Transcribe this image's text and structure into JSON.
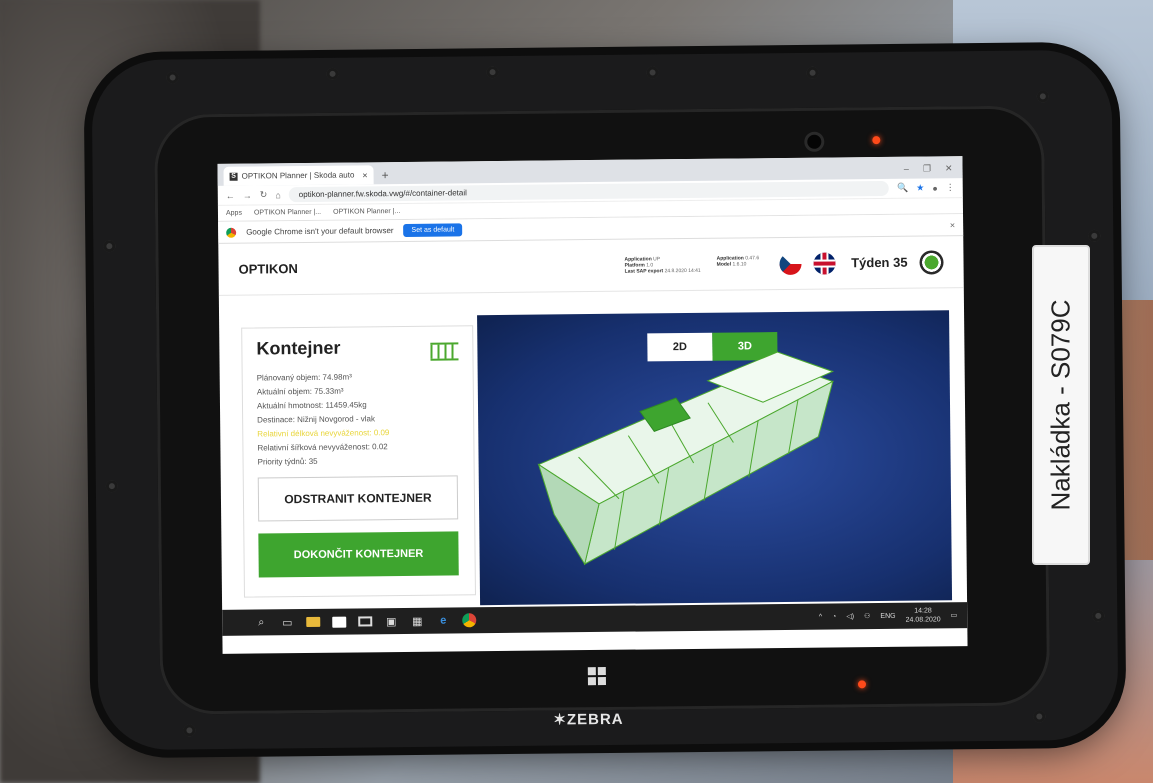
{
  "device": {
    "brand": "ZEBRA",
    "sticker_label": "Nakládka - S079C"
  },
  "browser": {
    "tab_title": "OPTIKON Planner | Skoda auto",
    "url": "optikon-planner.fw.skoda.vwg/#/container-detail",
    "bookmarks": [
      "Apps",
      "OPTIKON Planner |...",
      "OPTIKON Planner |..."
    ],
    "infobar_text": "Google Chrome isn't your default browser",
    "set_default_label": "Set as default"
  },
  "app": {
    "logo": "OPTIKON",
    "meta": {
      "application_label": "Application",
      "application_value": "UP",
      "platform_label": "Platform",
      "platform_value": "1.0",
      "last_export_label": "Last SAP export",
      "last_export_value": "24.8.2020 14:41",
      "app_version_label": "Application",
      "app_version_value": "0.47.6",
      "model_label": "Model",
      "model_value": "1.6.10"
    },
    "week_label": "Týden 35"
  },
  "container": {
    "title": "Kontejner",
    "planned_volume": "Plánovaný objem: 74.98m³",
    "actual_volume": "Aktuální objem: 75.33m³",
    "actual_weight": "Aktuální hmotnost: 11459.45kg",
    "destination": "Destinace: Nižnij Novgorod - vlak",
    "rel_length_imbalance": "Relativní délková nevyváženost: 0.09",
    "rel_width_imbalance": "Relativní šířková nevyváženost: 0.02",
    "week_priority": "Priority týdnů: 35",
    "remove_button": "ODSTRANIT KONTEJNER",
    "finish_button": "DOKONČIT KONTEJNER"
  },
  "viewer": {
    "mode_2d": "2D",
    "mode_3d": "3D",
    "active_mode": "3D"
  },
  "taskbar": {
    "language": "ENG",
    "time": "14:28",
    "date": "24.08.2020"
  },
  "colors": {
    "accent_green": "#3ea52f",
    "viewport_blue": "#1d3a86",
    "warning_yellow": "#e8d53a"
  }
}
